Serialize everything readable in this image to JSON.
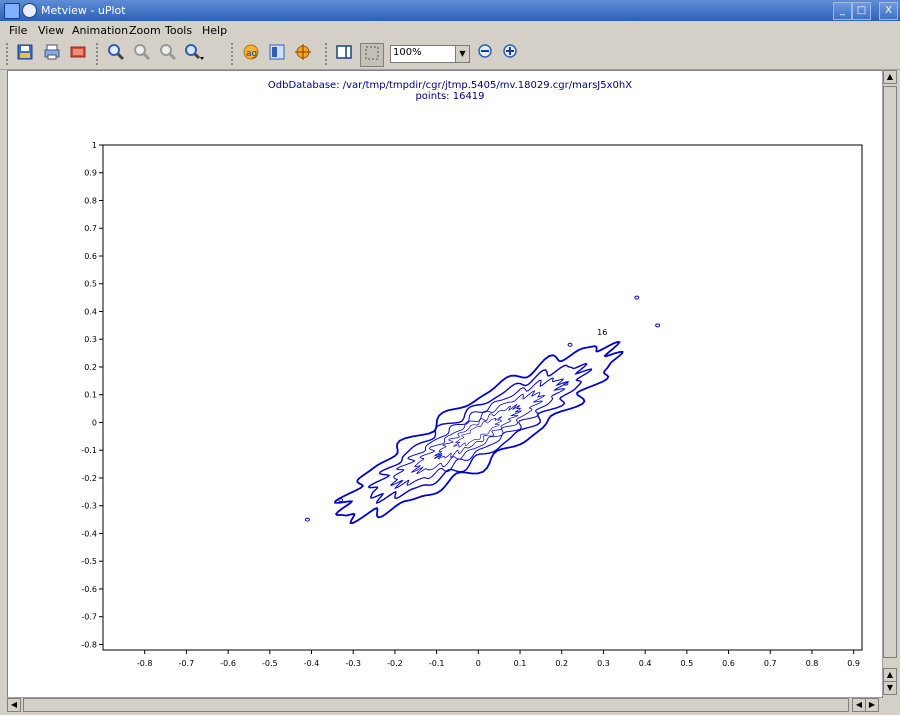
{
  "window": {
    "title": "Metview - uPlot",
    "min_label": "_",
    "max_label": "□",
    "close_label": "X"
  },
  "menu": [
    "File",
    "View",
    "Animation",
    "Zoom",
    "Tools",
    "Help"
  ],
  "toolbar": {
    "zoom_value": "100%"
  },
  "plot": {
    "title_line1": "OdbDatabase: /var/tmp/tmpdir/cgr/jtmp.5405/mv.18029.cgr/marsJ5x0hX",
    "title_line2": "points: 16419",
    "contour_label": "16"
  },
  "chart_data": {
    "type": "contour",
    "x_ticks": [
      "-0.8",
      "-0.7",
      "-0.6",
      "-0.5",
      "-0.4",
      "-0.3",
      "-0.2",
      "-0.1",
      "0",
      "0.1",
      "0.2",
      "0.3",
      "0.4",
      "0.5",
      "0.6",
      "0.7",
      "0.8",
      "0.9"
    ],
    "y_ticks": [
      "1",
      "0.9",
      "0.8",
      "0.7",
      "0.6",
      "0.5",
      "0.4",
      "0.3",
      "0.2",
      "0.1",
      "0",
      "-0.1",
      "-0.2",
      "-0.3",
      "-0.4",
      "-0.5",
      "-0.6",
      "-0.7",
      "-0.8"
    ],
    "xlim": [
      -0.9,
      0.92
    ],
    "ylim": [
      -0.82,
      1.0
    ],
    "line_color": "#0000cc"
  }
}
